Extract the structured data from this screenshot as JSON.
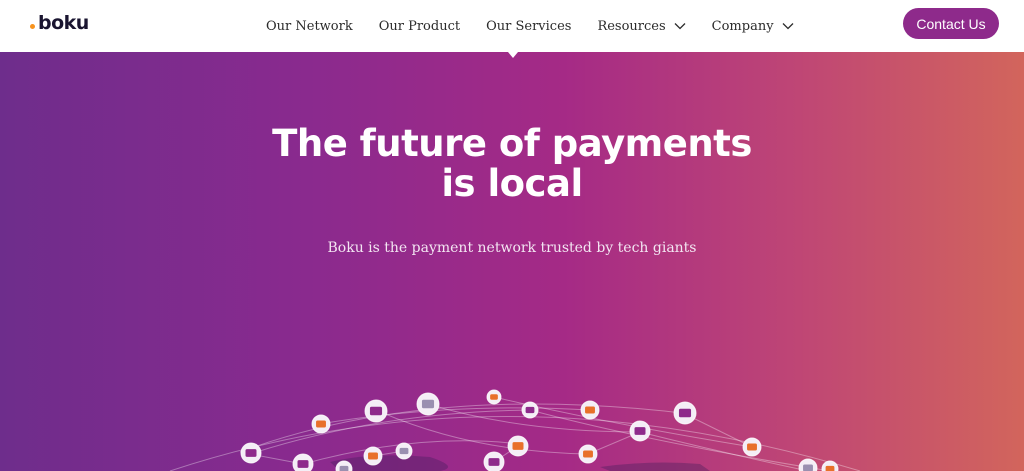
{
  "brand": {
    "name": "boku"
  },
  "nav": {
    "items": [
      {
        "label": "Our Network",
        "dropdown": false
      },
      {
        "label": "Our Product",
        "dropdown": false
      },
      {
        "label": "Our Services",
        "dropdown": false
      },
      {
        "label": "Resources",
        "dropdown": true
      },
      {
        "label": "Company",
        "dropdown": true
      }
    ],
    "cta": "Contact Us"
  },
  "hero": {
    "title_line1": "The future of payments",
    "title_line2": "is local",
    "subtitle": "Boku is the payment network trusted by tech giants"
  },
  "colors": {
    "accent": "#8e2a8b",
    "logo_dot": "#f7931e",
    "gradient_start": "#6e2d8c",
    "gradient_end": "#d2655c"
  },
  "icons": [
    "chevron-down-icon",
    "wallet-icon",
    "card-icon",
    "bank-icon",
    "payment-node-icon"
  ]
}
